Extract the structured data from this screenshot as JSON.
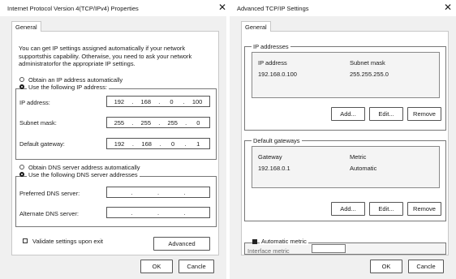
{
  "left_dialog": {
    "title": "Internet Protocol Version 4(TCP/IPv4) Properties",
    "tab_general": "General",
    "intro_text": "You can get IP settings assigned automatically if your network supportsthis capability. Otherwise, you need to ask your network administratorfor the appropriate IP settings.",
    "radio_auto_ip": "Obtain an IP address automatically",
    "radio_manual_ip": "Use the following IP address:",
    "ip_label": "IP address:",
    "ip_value": [
      "192",
      "168",
      "0",
      "100"
    ],
    "subnet_label": "Subnet mask:",
    "subnet_value": [
      "255",
      "255",
      "255",
      "0"
    ],
    "gateway_label": "Default gateway:",
    "gateway_value": [
      "192",
      "168",
      "0",
      "1"
    ],
    "radio_auto_dns": "Obtain DNS server address automatically",
    "radio_manual_dns": "Use the following DNS server addresses",
    "preferred_dns_label": "Preferred DNS server:",
    "alternate_dns_label": "Alternate DNS server:",
    "validate_label": "Validate settings upon exit",
    "advanced_button": "Advanced",
    "ok_button": "OK",
    "cancel_button": "Cancle",
    "close_icon": "✕"
  },
  "right_dialog": {
    "title": "Advanced TCP/IP Settings",
    "tab_general": "General",
    "ip_group_label": "IP addresses",
    "ip_col_address": "IP address",
    "ip_col_mask": "Subnet mask",
    "ip_rows": [
      {
        "address": "192.168.0.100",
        "mask": "255.255.255.0"
      }
    ],
    "ip_add": "Add...",
    "ip_edit": "Edit...",
    "ip_remove": "Remove",
    "gw_group_label": "Default gateways",
    "gw_col_gateway": "Gateway",
    "gw_col_metric": "Metric",
    "gw_rows": [
      {
        "gateway": "192.168.0.1",
        "metric": "Automatic"
      }
    ],
    "gw_add": "Add...",
    "gw_edit": "Edit...",
    "gw_remove": "Remove",
    "auto_metric_label": "Automatic metric",
    "interface_metric_label": "Interface metric",
    "ok_button": "OK",
    "cancel_button": "Cancle",
    "close_icon": "✕"
  }
}
